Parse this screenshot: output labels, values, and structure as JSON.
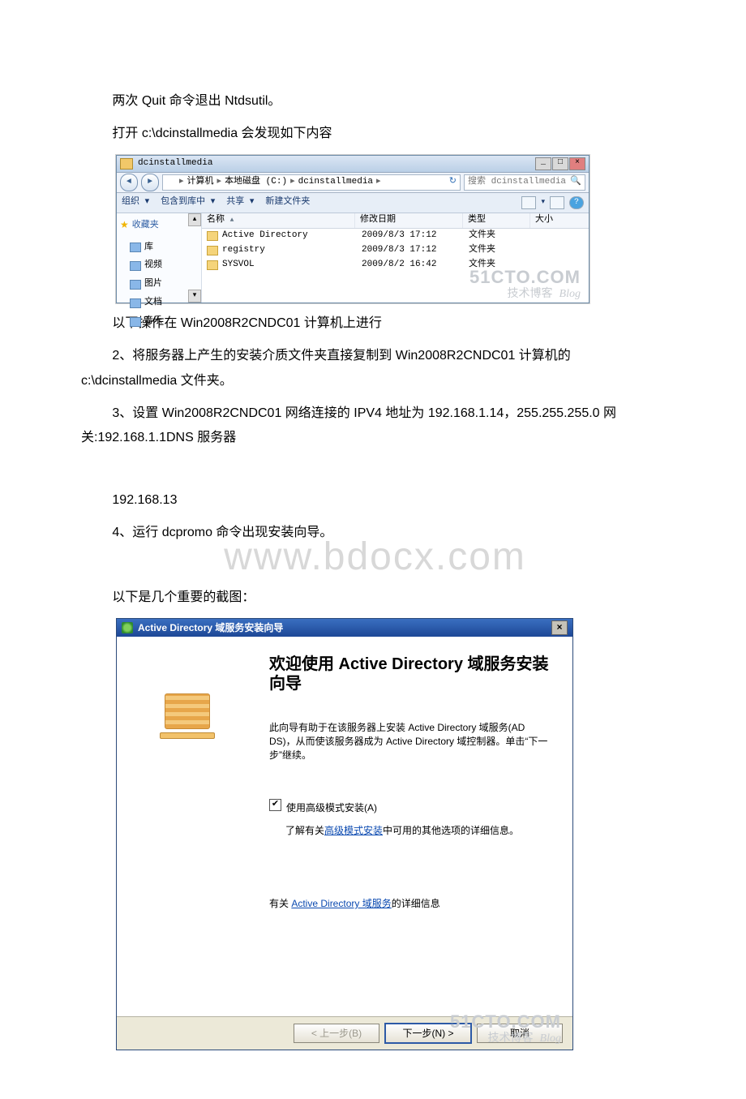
{
  "doc": {
    "p1": "两次 Quit 命令退出 Ntdsutil。",
    "p2": "打开 c:\\dcinstallmedia 会发现如下内容",
    "p3": "以下操作在 Win2008R2CNDC01 计算机上进行",
    "p4": "2、将服务器上产生的安装介质文件夹直接复制到 Win2008R2CNDC01 计算机的 c:\\dcinstallmedia 文件夹。",
    "p5": "3、设置 Win2008R2CNDC01 网络连接的 IPV4 地址为 192.168.1.14，255.255.255.0 网关:192.168.1.1DNS 服务器",
    "p6": "192.168.13",
    "p7": "4、运行 dcpromo 命令出现安装向导。",
    "p8": "以下是几个重要的截图："
  },
  "explorer": {
    "title": "dcinstallmedia",
    "crumbs": [
      "计算机",
      "本地磁盘 (C:)",
      "dcinstallmedia"
    ],
    "search_placeholder": "搜索 dcinstallmedia",
    "toolbar": {
      "organize": "组织",
      "include": "包含到库中",
      "share": "共享",
      "newfolder": "新建文件夹"
    },
    "nav": {
      "favorites": "收藏夹",
      "items": [
        "库",
        "视频",
        "图片",
        "文档",
        "音乐"
      ]
    },
    "columns": {
      "name": "名称",
      "date": "修改日期",
      "type": "类型",
      "size": "大小"
    },
    "sort_indicator": "▲",
    "rows": [
      {
        "name": "Active Directory",
        "date": "2009/8/3 17:12",
        "type": "文件夹",
        "size": ""
      },
      {
        "name": "registry",
        "date": "2009/8/3 17:12",
        "type": "文件夹",
        "size": ""
      },
      {
        "name": "SYSVOL",
        "date": "2009/8/2 16:42",
        "type": "文件夹",
        "size": ""
      }
    ],
    "winbtn": {
      "min": "_",
      "max": "□",
      "close": "×"
    }
  },
  "watermark": {
    "line1": "51CTO.COM",
    "line2a": "技术博客",
    "line2b": "Blog"
  },
  "bdocx": "www.bdocx.com",
  "wizard": {
    "title": "Active Directory 域服务安装向导",
    "close": "×",
    "heading": "欢迎使用 Active Directory 域服务安装向导",
    "desc": "此向导有助于在该服务器上安装 Active Directory 域服务(AD DS)，从而使该服务器成为 Active Directory 域控制器。单击“下一步”继续。",
    "advanced_label": "使用高级模式安装(A)",
    "advanced_sub_pre": "了解有关",
    "advanced_sub_link": "高级模式安装",
    "advanced_sub_post": "中可用的其他选项的详细信息。",
    "info_pre": "有关 ",
    "info_link": "Active Directory 域服务",
    "info_post": "的详细信息",
    "btn_back": "< 上一步(B)",
    "btn_next": "下一步(N) >",
    "btn_cancel": "取消"
  }
}
